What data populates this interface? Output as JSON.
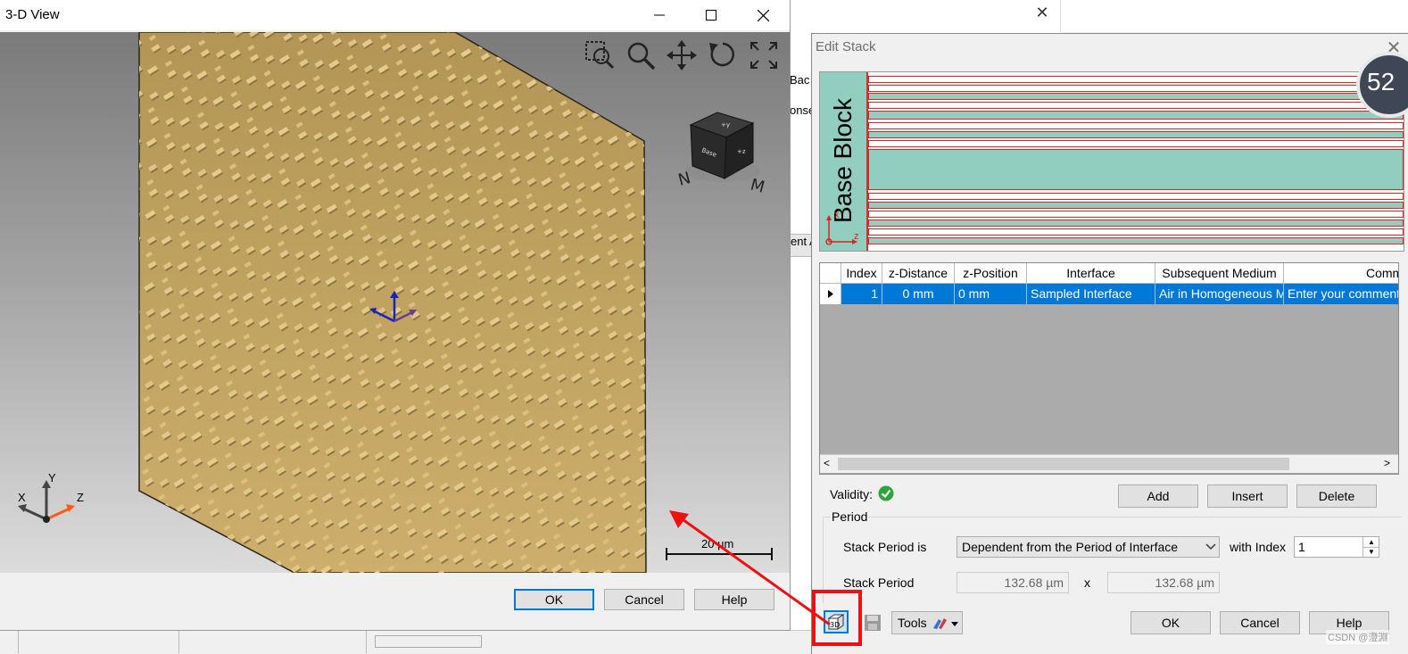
{
  "background_window": {
    "strip_1": "Bac",
    "strip_2": "onse",
    "strip_3": "ent A"
  },
  "view3d": {
    "title": "3-D View",
    "toolbar_icons": [
      "zoom-window-icon",
      "zoom-icon",
      "pan-icon",
      "rotate-icon",
      "fit-view-icon"
    ],
    "scale_bar": "20 µm",
    "axes": {
      "x": "X",
      "y": "Y",
      "z": "Z"
    },
    "ok_label": "OK",
    "cancel_label": "Cancel",
    "help_label": "Help"
  },
  "edit_stack": {
    "title": "Edit Stack",
    "base_block_label": "Base Block",
    "base_axes": {
      "x": "x",
      "z": "z"
    },
    "gauge_value": "52",
    "table": {
      "columns": [
        "Index",
        "z-Distance",
        "z-Position",
        "Interface",
        "Subsequent Medium",
        "Comm"
      ],
      "rows": [
        {
          "index": "1",
          "z_distance": "0 mm",
          "z_position": "0 mm",
          "interface": "Sampled Interface",
          "medium": "Air in Homogeneous M",
          "comment": "Enter your comment"
        }
      ]
    },
    "validity_label": "Validity:",
    "add_label": "Add",
    "insert_label": "Insert",
    "delete_label": "Delete",
    "period_group": "Period",
    "stack_period_is_label": "Stack Period is",
    "stack_period_mode": "Dependent from the Period of Interface",
    "with_index_label": "with Index",
    "with_index_value": "1",
    "stack_period_label": "Stack Period",
    "period_x": "132.68 µm",
    "times": "x",
    "period_y": "132.68 µm",
    "tools_label": "Tools",
    "ok_label": "OK",
    "cancel_label": "Cancel",
    "help_label": "Help"
  },
  "watermark": "CSDN @澄淵",
  "colors": {
    "selection": "#0078d7",
    "layer_fill": "#91cebf",
    "layer_border": "#dd2222",
    "highlight_box": "#ee1111",
    "surface": "#c9a96a"
  }
}
